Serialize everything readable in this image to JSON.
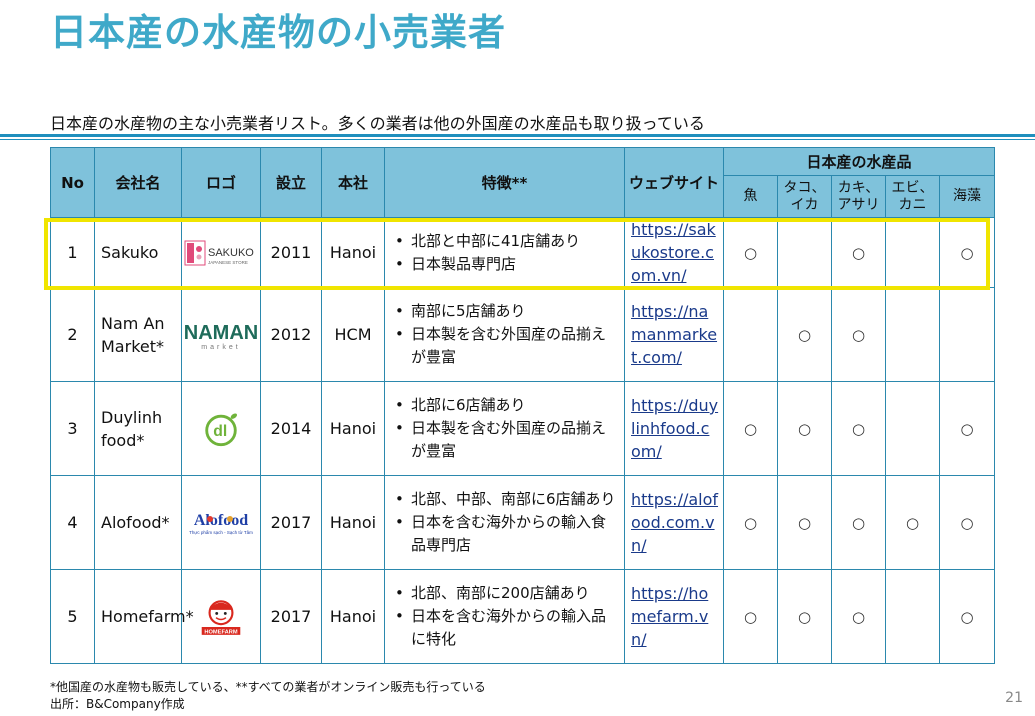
{
  "title": "日本産の水産物の小売業者",
  "subtitle": "日本産の水産物の主な小売業者リスト。多くの業者は他の外国産の水産品も取り扱っている",
  "table": {
    "headers": {
      "no": "No",
      "name": "会社名",
      "logo": "ロゴ",
      "founded": "設立",
      "hq": "本社",
      "features": "特徴**",
      "website": "ウェブサイト",
      "products_group": "日本産の水産品",
      "fish": "魚",
      "octopus_squid": "タコ、イカ",
      "oyster_clam": "カキ、アサリ",
      "shrimp_crab": "エビ、カニ",
      "seaweed": "海藻"
    },
    "rows": [
      {
        "no": "1",
        "name": "Sakuko",
        "logo_text": "SAKUKO",
        "logo_sub": "JAPANESE STORE",
        "founded": "2011",
        "hq": "Hanoi",
        "features": [
          "北部と中部に41店舗あり",
          "日本製品専門店"
        ],
        "website": "https://sakukostore.com.vn/",
        "marks": [
          "○",
          "",
          "○",
          "",
          "○"
        ]
      },
      {
        "no": "2",
        "name": "Nam An Market*",
        "logo_text": "NAMAN",
        "logo_sub": "market",
        "founded": "2012",
        "hq": "HCM",
        "features": [
          "南部に5店舗あり",
          "日本製を含む外国産の品揃えが豊富"
        ],
        "website": "https://namanmarket.com/",
        "marks": [
          "",
          "○",
          "○",
          "",
          ""
        ]
      },
      {
        "no": "3",
        "name": "Duylinh food*",
        "logo_text": "dl",
        "founded": "2014",
        "hq": "Hanoi",
        "features": [
          "北部に6店舗あり",
          "日本製を含む外国産の品揃えが豊富"
        ],
        "website": "https://duylinhfood.com/",
        "marks": [
          "○",
          "○",
          "○",
          "",
          "○"
        ]
      },
      {
        "no": "4",
        "name": "Alofood*",
        "logo_text": "Alofood",
        "logo_sub": "Thực phẩm sạch - Sạch từ Tâm",
        "founded": "2017",
        "hq": "Hanoi",
        "features": [
          "北部、中部、南部に6店舗あり",
          "日本を含む海外からの輸入食品専門店"
        ],
        "website": "https://alofood.com.vn/",
        "marks": [
          "○",
          "○",
          "○",
          "○",
          "○"
        ]
      },
      {
        "no": "5",
        "name": "Homefarm*",
        "logo_text": "HOMEFARM",
        "founded": "2017",
        "hq": "Hanoi",
        "features": [
          "北部、南部に200店舗あり",
          "日本を含む海外からの輸入品に特化"
        ],
        "website": "https://homefarm.vn/",
        "marks": [
          "○",
          "○",
          "○",
          "",
          "○"
        ]
      }
    ]
  },
  "footnote": "*他国産の水産物も販売している、**すべての業者がオンライン販売も行っている",
  "source": "出所：B&Company作成",
  "page_number": "21",
  "colors": {
    "title": "#3fa9c9",
    "header_bg": "#7fc2db",
    "border": "#2b88ad",
    "highlight": "#f0e500",
    "rule": "#1f8fbd"
  }
}
